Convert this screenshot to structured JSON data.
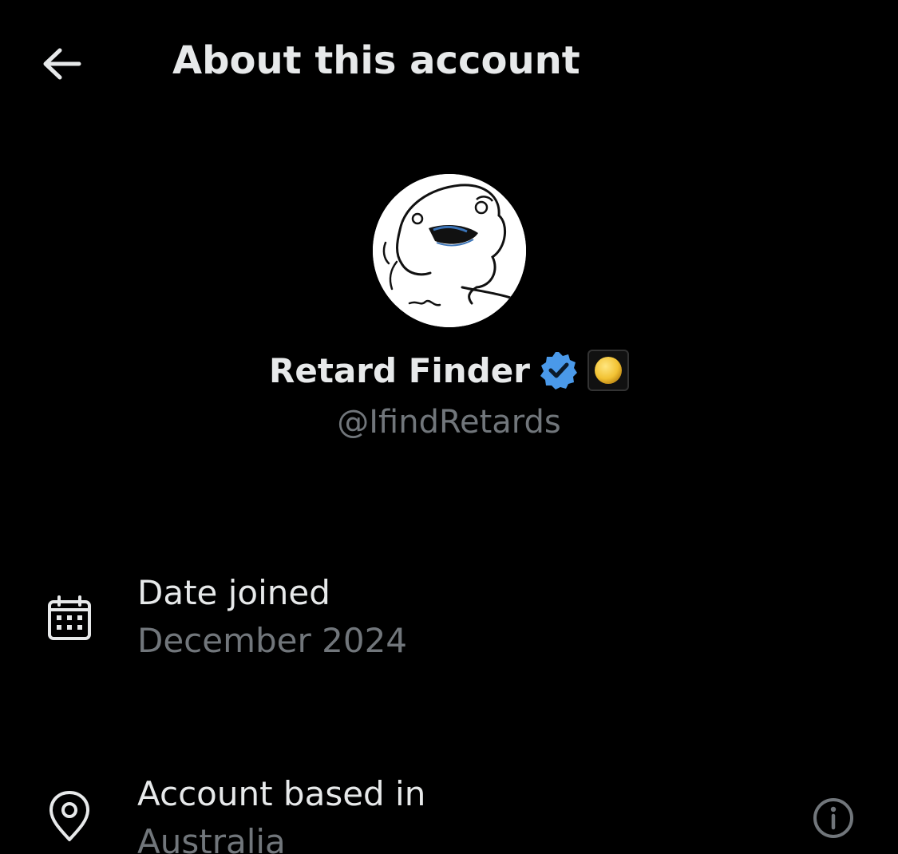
{
  "header": {
    "title": "About this account",
    "back_icon": "arrow-left-icon"
  },
  "profile": {
    "display_name": "Retard Finder",
    "handle": "@IfindRetards",
    "verified_badge_color": "#4a99e9",
    "verified_icon": "verified-check-icon",
    "status_emoji_icon": "yellow-circle-icon"
  },
  "details": [
    {
      "icon": "calendar-icon",
      "label": "Date joined",
      "value": "December 2024"
    },
    {
      "icon": "location-pin-icon",
      "label": "Account based in",
      "value": "Australia",
      "action_icon": "info-icon"
    }
  ],
  "colors": {
    "background": "#000000",
    "primary_text": "#e7e9ea",
    "secondary_text": "#71767b",
    "accent": "#4a99e9"
  }
}
